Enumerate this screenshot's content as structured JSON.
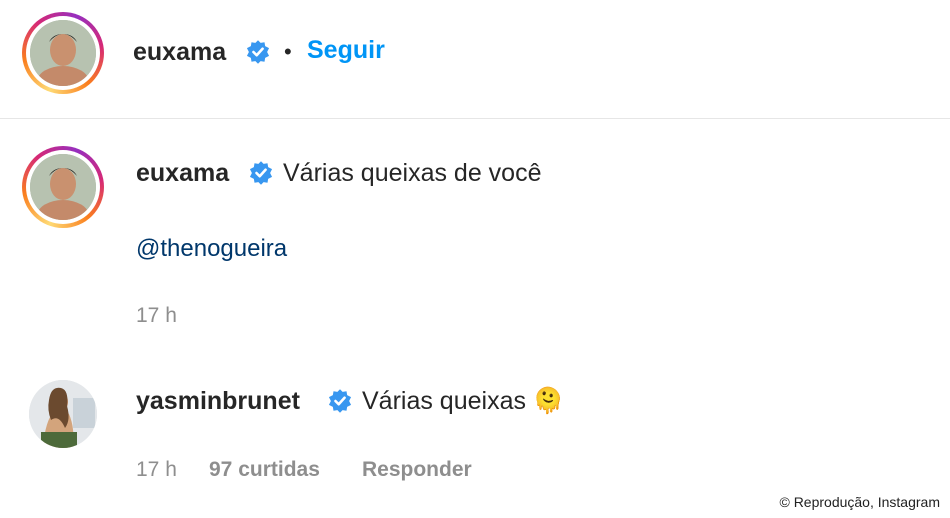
{
  "header": {
    "username": "euxama",
    "separator": "•",
    "follow_label": "Seguir"
  },
  "comments": [
    {
      "username": "euxama",
      "text": "Várias queixas de você",
      "mention": "@thenogueira",
      "time": "17 h"
    },
    {
      "username": "yasminbrunet",
      "text": "Várias queixas 🫠",
      "time": "17 h",
      "likes": "97 curtidas",
      "reply_label": "Responder"
    }
  ],
  "credit": "© Reprodução, Instagram",
  "colors": {
    "link_blue": "#0095f6",
    "mention_blue": "#00376b",
    "verified_blue": "#3897f0",
    "muted": "#8e8e8e"
  }
}
